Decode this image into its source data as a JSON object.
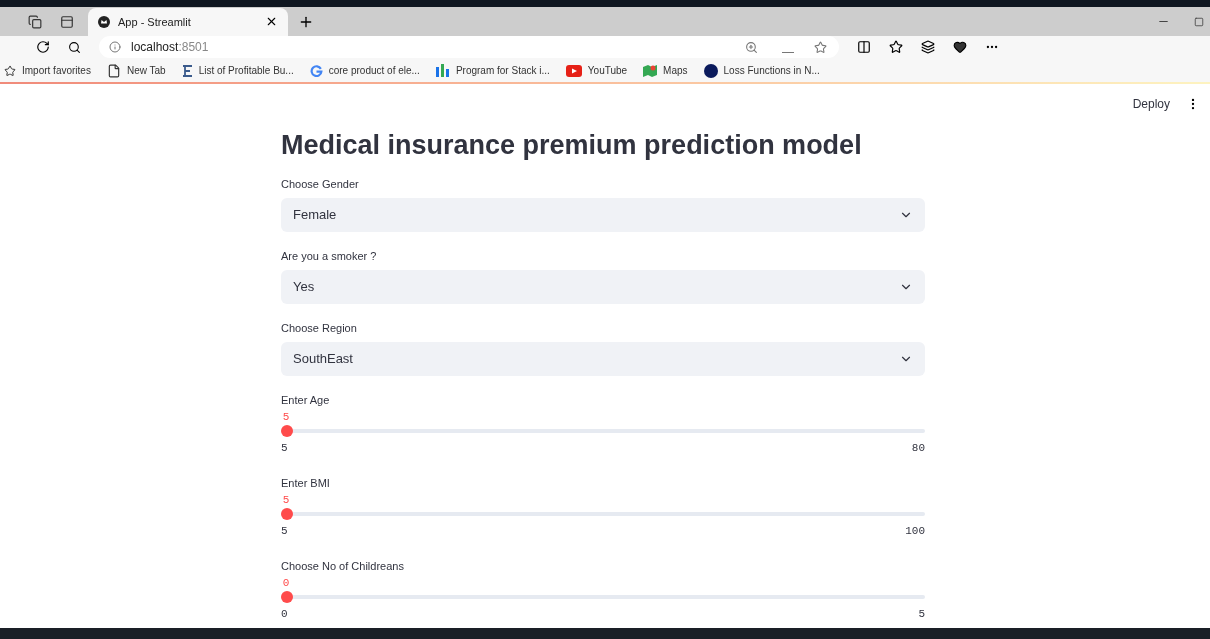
{
  "browser": {
    "tab_title": "App - Streamlit",
    "url_host": "localhost",
    "url_port": ":8501",
    "bookmarks": [
      {
        "kind": "star",
        "label": "Import favorites"
      },
      {
        "kind": "page",
        "label": "New Tab"
      },
      {
        "kind": "letter",
        "label": "List of Profitable Bu..."
      },
      {
        "kind": "g",
        "label": "core product of ele..."
      },
      {
        "kind": "bars",
        "label": "Program for Stack i..."
      },
      {
        "kind": "video",
        "label": "YouTube"
      },
      {
        "kind": "map",
        "label": "Maps"
      },
      {
        "kind": "circle",
        "label": "Loss Functions in N..."
      }
    ]
  },
  "app": {
    "deploy": "Deploy",
    "title": "Medical insurance premium prediction model",
    "selects": [
      {
        "label": "Choose Gender",
        "value": "Female"
      },
      {
        "label": "Are you a smoker ?",
        "value": "Yes"
      },
      {
        "label": "Choose Region",
        "value": "SouthEast"
      }
    ],
    "sliders": [
      {
        "label": "Enter Age",
        "value": "5",
        "min": "5",
        "max": "80",
        "level": 0
      },
      {
        "label": "Enter BMI",
        "value": "5",
        "min": "5",
        "max": "100",
        "level": 0
      },
      {
        "label": "Choose No of Childreans",
        "value": "0",
        "min": "0",
        "max": "5",
        "level": 0
      }
    ]
  }
}
